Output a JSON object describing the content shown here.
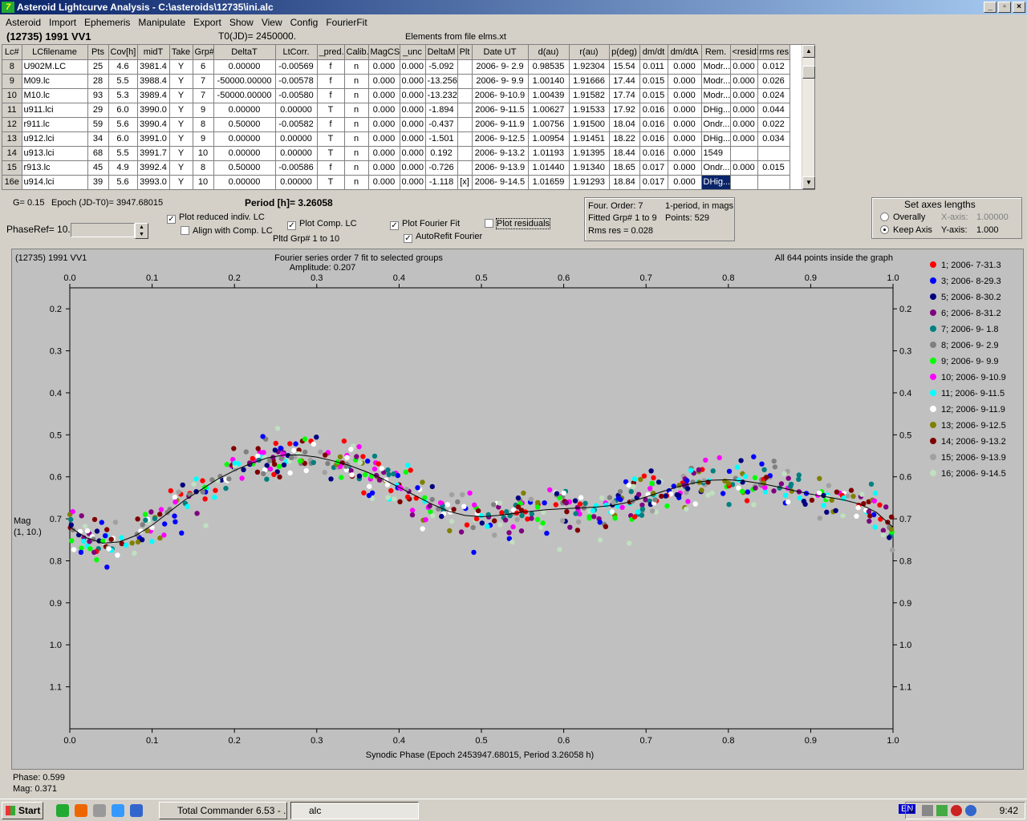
{
  "window": {
    "title": "Asteroid Lightcurve Analysis - C:\\asteroids\\12735\\ini.alc",
    "app_icon": "7"
  },
  "menu": [
    "Asteroid",
    "Import",
    "Ephemeris",
    "Manipulate",
    "Export",
    "Show",
    "View",
    "Config",
    "FourierFit"
  ],
  "header": {
    "object": "(12735) 1991 VV1",
    "t0": "T0(JD)= 2450000.",
    "elements": "Elements from file elms.xt"
  },
  "grid": {
    "columns": [
      "Lc#",
      "LCfilename",
      "Pts",
      "Cov[h]",
      "midT",
      "Take",
      "Grp#",
      "DeltaT",
      "LtCorr.",
      "_pred.",
      "Calib.",
      "MagCS",
      "_unc",
      "DeltaM",
      "Plt",
      "Date UT",
      "d(au)",
      "r(au)",
      "p(deg)",
      "dm/dt",
      "dm/dtA",
      "Rem.",
      "<resid>",
      "rms res"
    ],
    "rows": [
      [
        "8",
        "U902M.LC",
        "25",
        "4.6",
        "3981.4",
        "Y",
        "6",
        "0.00000",
        "-0.00569",
        "f",
        "n",
        "0.000",
        "0.000",
        "-5.092",
        "",
        "2006- 9- 2.9",
        "0.98535",
        "1.92304",
        "15.54",
        "0.011",
        "0.000",
        "Modr...",
        "0.000",
        "0.012"
      ],
      [
        "9",
        "M09.lc",
        "28",
        "5.5",
        "3988.4",
        "Y",
        "7",
        "-50000.00000",
        "-0.00578",
        "f",
        "n",
        "0.000",
        "0.000",
        "-13.256",
        "",
        "2006- 9- 9.9",
        "1.00140",
        "1.91666",
        "17.44",
        "0.015",
        "0.000",
        "Modr...",
        "0.000",
        "0.026"
      ],
      [
        "10",
        "M10.lc",
        "93",
        "5.3",
        "3989.4",
        "Y",
        "7",
        "-50000.00000",
        "-0.00580",
        "f",
        "n",
        "0.000",
        "0.000",
        "-13.232",
        "",
        "2006- 9-10.9",
        "1.00439",
        "1.91582",
        "17.74",
        "0.015",
        "0.000",
        "Modr...",
        "0.000",
        "0.024"
      ],
      [
        "11",
        "u911.lci",
        "29",
        "6.0",
        "3990.0",
        "Y",
        "9",
        "0.00000",
        "0.00000",
        "T",
        "n",
        "0.000",
        "0.000",
        "-1.894",
        "",
        "2006- 9-11.5",
        "1.00627",
        "1.91533",
        "17.92",
        "0.016",
        "0.000",
        "DHig...",
        "0.000",
        "0.044"
      ],
      [
        "12",
        "r911.lc",
        "59",
        "5.6",
        "3990.4",
        "Y",
        "8",
        "0.50000",
        "-0.00582",
        "f",
        "n",
        "0.000",
        "0.000",
        "-0.437",
        "",
        "2006- 9-11.9",
        "1.00756",
        "1.91500",
        "18.04",
        "0.016",
        "0.000",
        "Ondr...",
        "0.000",
        "0.022"
      ],
      [
        "13",
        "u912.lci",
        "34",
        "6.0",
        "3991.0",
        "Y",
        "9",
        "0.00000",
        "0.00000",
        "T",
        "n",
        "0.000",
        "0.000",
        "-1.501",
        "",
        "2006- 9-12.5",
        "1.00954",
        "1.91451",
        "18.22",
        "0.016",
        "0.000",
        "DHig...",
        "0.000",
        "0.034"
      ],
      [
        "14",
        "u913.lci",
        "68",
        "5.5",
        "3991.7",
        "Y",
        "10",
        "0.00000",
        "0.00000",
        "T",
        "n",
        "0.000",
        "0.000",
        "0.192",
        "",
        "2006- 9-13.2",
        "1.01193",
        "1.91395",
        "18.44",
        "0.016",
        "0.000",
        "1549",
        "",
        ""
      ],
      [
        "15",
        "r913.lc",
        "45",
        "4.9",
        "3992.4",
        "Y",
        "8",
        "0.50000",
        "-0.00586",
        "f",
        "n",
        "0.000",
        "0.000",
        "-0.726",
        "",
        "2006- 9-13.9",
        "1.01440",
        "1.91340",
        "18.65",
        "0.017",
        "0.000",
        "Ondr...",
        "0.000",
        "0.015"
      ],
      [
        "16e",
        "u914.lci",
        "39",
        "5.6",
        "3993.0",
        "Y",
        "10",
        "0.00000",
        "0.00000",
        "T",
        "n",
        "0.000",
        "0.000",
        "-1.118",
        "[x]",
        "2006- 9-14.5",
        "1.01659",
        "1.91293",
        "18.84",
        "0.017",
        "0.000",
        "DHig...",
        "",
        ""
      ]
    ]
  },
  "controls": {
    "g": "G= 0.15",
    "epoch": "Epoch (JD-T0)= 3947.68015",
    "period": "Period [h]= 3.26058",
    "phaseref": "PhaseRef= 10.",
    "plot_reduced": "Plot reduced indiv. LC",
    "align_comp": "Align with Comp. LC",
    "plot_comp": "Plot Comp. LC",
    "pltd_grp": "Pltd Grp#  1   to   10",
    "plot_fourier": "Plot Fourier Fit",
    "autorefit": "AutoRefit Fourier",
    "plot_residuals": "Plot residuals",
    "check": "✓"
  },
  "fit_info": {
    "order": "Four. Order:  7",
    "period_note": "1-period, in mags",
    "fitted": "Fitted Grp# 1 to 9",
    "points": "Points: 529",
    "rms": "Rms res      = 0.028"
  },
  "axes_panel": {
    "title": "Set axes lengths",
    "overally": "Overally",
    "keep": "Keep Axis",
    "x_label": "X-axis:",
    "x_val": "1.00000",
    "y_label": "Y-axis:",
    "y_val": "1.000"
  },
  "plot": {
    "object": "(12735) 1991 VV1",
    "title": "Fourier series order 7 fit to selected groups",
    "amplitude": "Amplitude: 0.207",
    "inside": "All 644 points inside the graph",
    "ylabel1": "Mag",
    "ylabel2": "(1, 10.)",
    "xlabel": "Synodic Phase (Epoch 2453947.68015, Period 3.26058 h)",
    "bg": "#c0c0c0"
  },
  "chart_data": {
    "type": "scatter",
    "xlim": [
      0.0,
      1.0
    ],
    "ylim": [
      0.15,
      1.2
    ],
    "y_inverted": true,
    "x_ticks": [
      "0.0",
      "0.1",
      "0.2",
      "0.3",
      "0.4",
      "0.5",
      "0.6",
      "0.7",
      "0.8",
      "0.9",
      "1.0"
    ],
    "y_ticks": [
      "0.2",
      "0.3",
      "0.4",
      "0.5",
      "0.6",
      "0.7",
      "0.8",
      "0.9",
      "1.0",
      "1.1"
    ],
    "series": [
      {
        "name": "1; 2006- 7-31.3",
        "color": "#ff0000"
      },
      {
        "name": "3; 2006- 8-29.3",
        "color": "#0000ff"
      },
      {
        "name": "5; 2006- 8-30.2",
        "color": "#000080"
      },
      {
        "name": "6; 2006- 8-31.2",
        "color": "#800080"
      },
      {
        "name": "7; 2006- 9- 1.8",
        "color": "#008080"
      },
      {
        "name": "8; 2006- 9- 2.9",
        "color": "#808080"
      },
      {
        "name": "9; 2006- 9- 9.9",
        "color": "#00ff00"
      },
      {
        "name": "10; 2006- 9-10.9",
        "color": "#ff00ff"
      },
      {
        "name": "11; 2006- 9-11.5",
        "color": "#00ffff"
      },
      {
        "name": "12; 2006- 9-11.9",
        "color": "#ffffff"
      },
      {
        "name": "13; 2006- 9-12.5",
        "color": "#808000"
      },
      {
        "name": "14; 2006- 9-13.2",
        "color": "#800000"
      },
      {
        "name": "15; 2006- 9-13.9",
        "color": "#a0a0a0"
      },
      {
        "name": "16; 2006- 9-14.5",
        "color": "#c0e0c0"
      }
    ],
    "fourier_fit": {
      "x": [
        0.0,
        0.02,
        0.04,
        0.06,
        0.08,
        0.1,
        0.12,
        0.14,
        0.16,
        0.18,
        0.2,
        0.22,
        0.24,
        0.26,
        0.28,
        0.3,
        0.32,
        0.34,
        0.36,
        0.38,
        0.4,
        0.42,
        0.44,
        0.46,
        0.48,
        0.5,
        0.52,
        0.54,
        0.56,
        0.58,
        0.6,
        0.62,
        0.64,
        0.66,
        0.68,
        0.7,
        0.72,
        0.74,
        0.76,
        0.78,
        0.8,
        0.82,
        0.84,
        0.86,
        0.88,
        0.9,
        0.92,
        0.94,
        0.96,
        0.98,
        1.0
      ],
      "y": [
        0.72,
        0.745,
        0.758,
        0.755,
        0.74,
        0.715,
        0.685,
        0.655,
        0.63,
        0.605,
        0.585,
        0.568,
        0.555,
        0.548,
        0.548,
        0.553,
        0.562,
        0.573,
        0.588,
        0.605,
        0.625,
        0.645,
        0.665,
        0.682,
        0.692,
        0.695,
        0.692,
        0.687,
        0.682,
        0.678,
        0.676,
        0.674,
        0.672,
        0.668,
        0.66,
        0.648,
        0.635,
        0.623,
        0.614,
        0.608,
        0.607,
        0.61,
        0.616,
        0.624,
        0.633,
        0.641,
        0.648,
        0.655,
        0.665,
        0.685,
        0.72
      ]
    },
    "points_shown": 644
  },
  "status": {
    "phase": "Phase:  0.599",
    "mag": "Mag:    0.371"
  },
  "taskbar": {
    "start": "Start",
    "items": [
      {
        "label": "Total Commander 6.53 - ...",
        "active": false
      },
      {
        "label": "alc",
        "active": true
      }
    ],
    "lang": "EN",
    "time": "9:42"
  }
}
